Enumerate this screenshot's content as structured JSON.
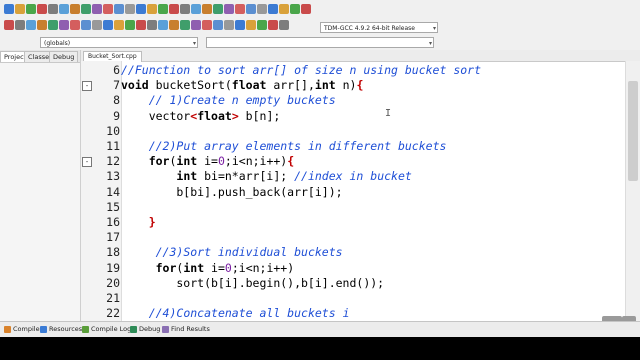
{
  "toolbar": {
    "compiler_label": "TDM-GCC 4.9.2 64-bit Release",
    "globals_label": "(globals)"
  },
  "left_panel": {
    "tabs": [
      "Project",
      "Classes",
      "Debug"
    ]
  },
  "editor": {
    "file_tab": "Bucket_Sort.cpp",
    "lines": [
      {
        "n": "6",
        "parts": [
          {
            "c": "cmt",
            "t": "//Function to sort arr[] of size n using bucket sort"
          }
        ]
      },
      {
        "n": "7",
        "fold": "-",
        "parts": [
          {
            "c": "kw",
            "t": "void"
          },
          {
            "c": "plain",
            "t": " bucketSort("
          },
          {
            "c": "kw",
            "t": "float"
          },
          {
            "c": "plain",
            "t": " arr[],"
          },
          {
            "c": "kw",
            "t": "int"
          },
          {
            "c": "plain",
            "t": " n)"
          },
          {
            "c": "sym",
            "t": "{"
          }
        ]
      },
      {
        "n": "8",
        "parts": [
          {
            "c": "plain",
            "t": "    "
          },
          {
            "c": "cmt",
            "t": "// 1)Create n empty buckets"
          }
        ]
      },
      {
        "n": "9",
        "parts": [
          {
            "c": "plain",
            "t": "    vector"
          },
          {
            "c": "sym",
            "t": "<"
          },
          {
            "c": "kw",
            "t": "float"
          },
          {
            "c": "sym",
            "t": ">"
          },
          {
            "c": "plain",
            "t": " b[n];"
          }
        ]
      },
      {
        "n": "10",
        "parts": []
      },
      {
        "n": "11",
        "parts": [
          {
            "c": "plain",
            "t": "    "
          },
          {
            "c": "cmt",
            "t": "//2)Put array elements in different buckets"
          }
        ]
      },
      {
        "n": "12",
        "fold": "-",
        "parts": [
          {
            "c": "plain",
            "t": "    "
          },
          {
            "c": "kw",
            "t": "for"
          },
          {
            "c": "plain",
            "t": "("
          },
          {
            "c": "kw",
            "t": "int"
          },
          {
            "c": "plain",
            "t": " i="
          },
          {
            "c": "num",
            "t": "0"
          },
          {
            "c": "plain",
            "t": ";i<n;i++)"
          },
          {
            "c": "sym",
            "t": "{"
          }
        ]
      },
      {
        "n": "13",
        "parts": [
          {
            "c": "plain",
            "t": "        "
          },
          {
            "c": "kw",
            "t": "int"
          },
          {
            "c": "plain",
            "t": " bi=n*arr[i]; "
          },
          {
            "c": "cmt",
            "t": "//index in bucket"
          }
        ]
      },
      {
        "n": "14",
        "parts": [
          {
            "c": "plain",
            "t": "        b[bi].push_back(arr[i]);"
          }
        ]
      },
      {
        "n": "15",
        "parts": []
      },
      {
        "n": "16",
        "parts": [
          {
            "c": "plain",
            "t": "    "
          },
          {
            "c": "sym",
            "t": "}"
          }
        ]
      },
      {
        "n": "17",
        "parts": []
      },
      {
        "n": "18",
        "parts": [
          {
            "c": "plain",
            "t": "     "
          },
          {
            "c": "cmt",
            "t": "//3)Sort individual buckets"
          }
        ]
      },
      {
        "n": "19",
        "parts": [
          {
            "c": "plain",
            "t": "     "
          },
          {
            "c": "kw",
            "t": "for"
          },
          {
            "c": "plain",
            "t": "("
          },
          {
            "c": "kw",
            "t": "int"
          },
          {
            "c": "plain",
            "t": " i="
          },
          {
            "c": "num",
            "t": "0"
          },
          {
            "c": "plain",
            "t": ";i<n;i++)"
          }
        ]
      },
      {
        "n": "20",
        "parts": [
          {
            "c": "plain",
            "t": "        sort(b[i].begin(),b[i].end());"
          }
        ]
      },
      {
        "n": "21",
        "parts": []
      },
      {
        "n": "22",
        "parts": [
          {
            "c": "plain",
            "t": "    "
          },
          {
            "c": "cmt",
            "t": "//4)Concatenate all buckets i"
          }
        ]
      }
    ]
  },
  "bottom_tabs": [
    {
      "label": "Compiler",
      "color": "#d9822b"
    },
    {
      "label": "Resources",
      "color": "#3a7bd5"
    },
    {
      "label": "Compile Log",
      "color": "#5a9e3a"
    },
    {
      "label": "Debug",
      "color": "#2e8b57"
    },
    {
      "label": "Find Results",
      "color": "#8a6fb3"
    }
  ],
  "colors": {
    "comment": "#1f4fd6",
    "symbol": "#c00000"
  }
}
